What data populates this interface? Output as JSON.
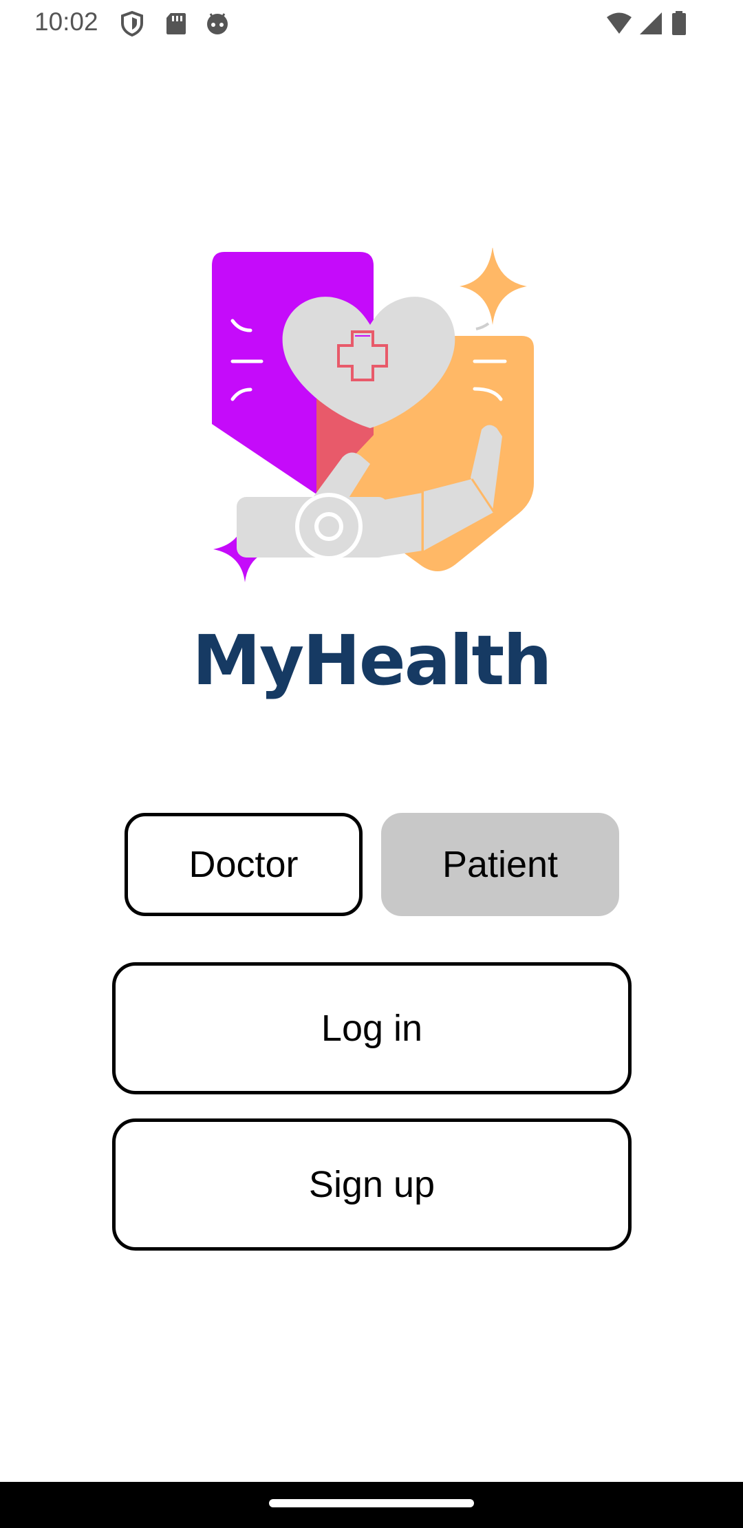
{
  "status_bar": {
    "time": "10:02",
    "icons_left": [
      "shield-icon",
      "sd-card-icon",
      "android-icon"
    ],
    "icons_right": [
      "wifi-icon",
      "cell-signal-icon",
      "battery-icon"
    ]
  },
  "app": {
    "name": "MyHealth",
    "brand_color": "#163a63",
    "accent_colors": [
      "#c50bfa",
      "#ffb866",
      "#e85a6a",
      "#dddddd"
    ]
  },
  "role_selector": {
    "doctor_label": "Doctor",
    "patient_label": "Patient",
    "selected": "Patient"
  },
  "actions": {
    "login_label": "Log in",
    "signup_label": "Sign up"
  }
}
